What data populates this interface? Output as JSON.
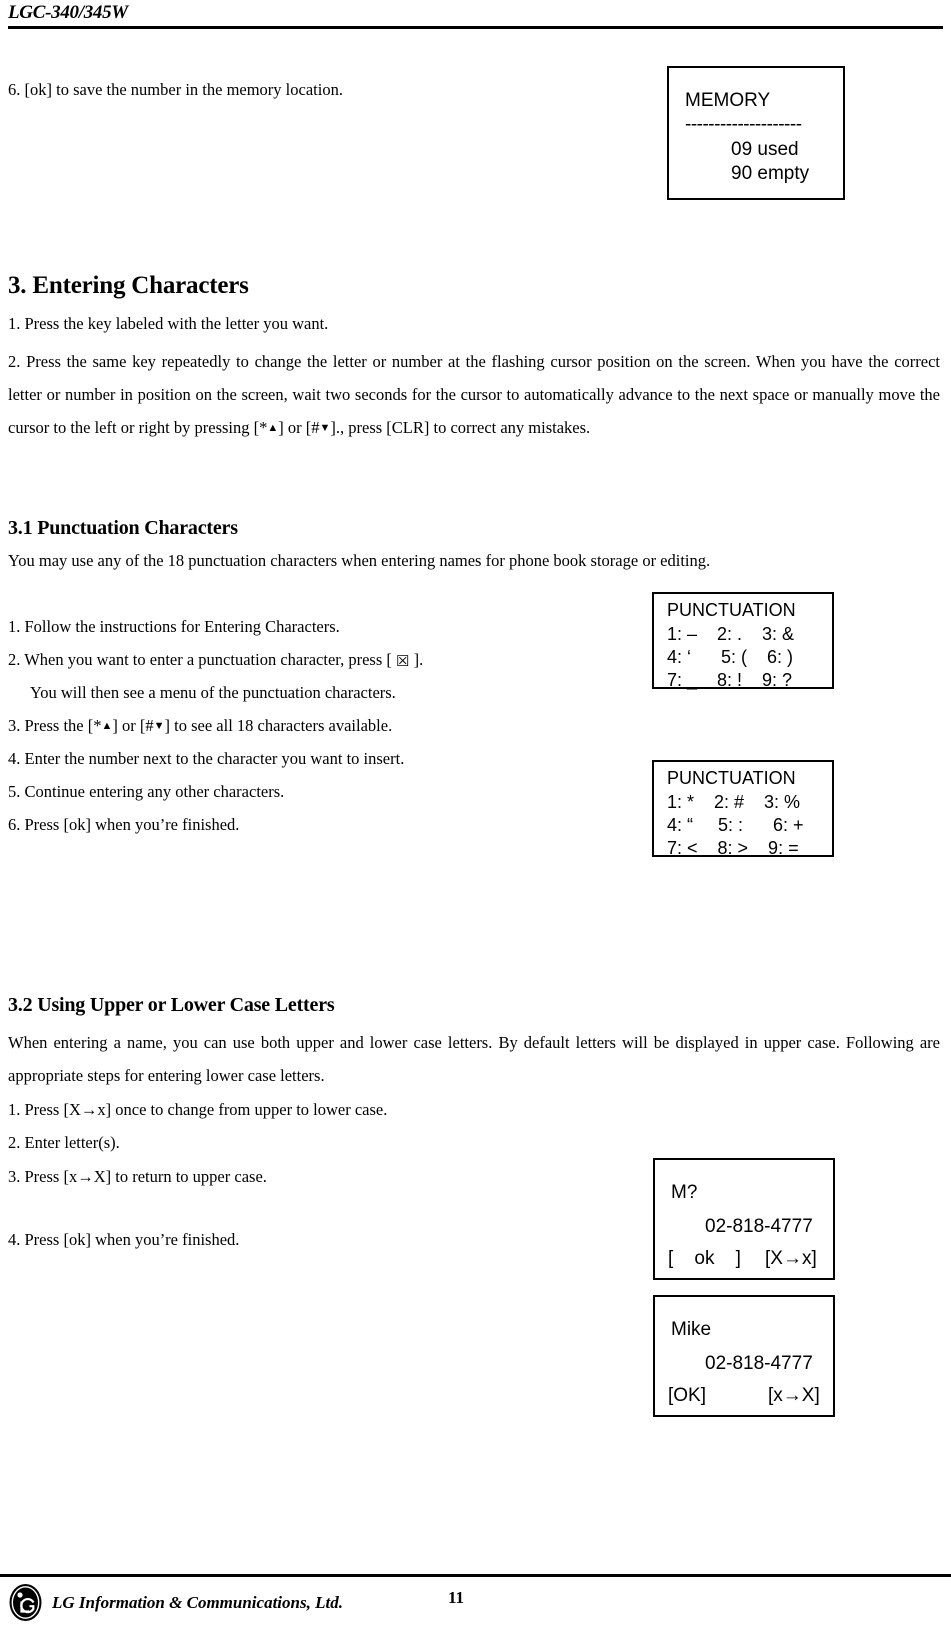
{
  "header": {
    "model": "LGC-340/345W"
  },
  "footer": {
    "company": "LG Information & Communications, Ltd.",
    "page_number": "11",
    "logo_icon": "lg-logo-icon"
  },
  "content": {
    "step6_memory": "6. [ok] to save the number in the memory location.",
    "section3": {
      "heading": "3. Entering Characters",
      "step1": "1. Press the key labeled with the letter you want.",
      "step2_prefix": "2. Press the same key repeatedly to change the letter or number at the flashing cursor position on the screen. When you have the correct letter or number in position on the screen, wait two seconds for the cursor to automatically advance to the next space or manually move the cursor to the left or right by pressing [*",
      "step2_mid": "] or [#",
      "step2_suffix": "]., press    [CLR] to correct any mistakes.",
      "arrow_up": "▲",
      "arrow_down": "▼"
    },
    "section31": {
      "heading": "3.1 Punctuation Characters",
      "intro": "You may use any of the 18 punctuation characters when entering names for phone book storage or editing.",
      "step1": "1. Follow the instructions for Entering Characters.",
      "step2_a": "2. When you want to enter a punctuation character, press [ ",
      "envelope_icon": "☒",
      "step2_b": " ].",
      "step2_cont": "You will then see a menu of the punctuation characters.",
      "step3_a": "3. Press the [*",
      "step3_b": "] or [#",
      "step3_c": "] to see all 18 characters available.",
      "step4": "4. Enter the number next to the character you want to insert.",
      "step5": "5. Continue entering any other characters.",
      "step6": "6. Press [ok] when you’re finished."
    },
    "section32": {
      "heading": "3.2 Using Upper or Lower Case Letters",
      "intro": "When entering a name, you can use both upper and lower case letters. By default letters will be displayed in upper case. Following are appropriate steps for entering lower case letters.",
      "step1": "1. Press [X→x] once to change from upper to lower case.",
      "step2": "2. Enter letter(s).",
      "step3": "3. Press [x→X] to return to upper case.",
      "step4": "4. Press [ok] when you’re finished."
    }
  },
  "lcd_screens": {
    "memory": {
      "title": "MEMORY",
      "divider": "--------------------",
      "used": "09 used",
      "empty": "90 empty"
    },
    "punctuation_1": {
      "title": "PUNCTUATION",
      "row1": "1: –    2: .    3: &",
      "row2": "4: ‘      5: (    6: )",
      "row3": "7: _    8: !    9: ?"
    },
    "punctuation_2": {
      "title": "PUNCTUATION",
      "row1": "1: *    2: #    3: %",
      "row2": "4: “     5: :      6: +",
      "row3": "7: <    8: >    9: ="
    },
    "name_entry": {
      "name": "M?",
      "number": "02-818-4777",
      "softkey_left": "[    ok    ]",
      "softkey_right": "[X→x]"
    },
    "name_done": {
      "name": "Mike",
      "number": "02-818-4777",
      "softkey_left": "[OK]",
      "softkey_right": "[x→X]"
    }
  }
}
